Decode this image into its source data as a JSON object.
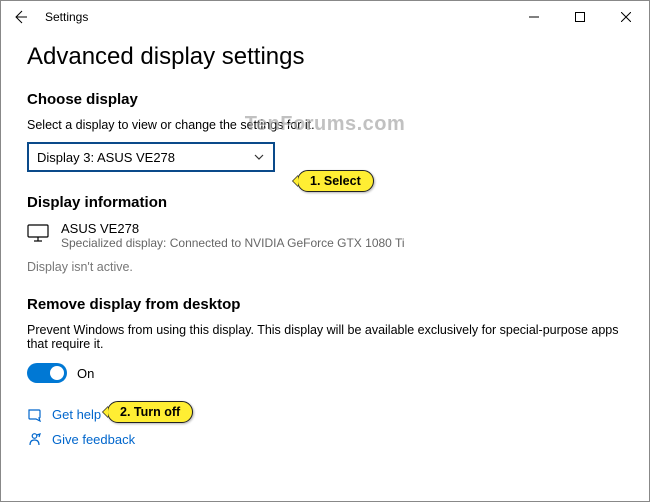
{
  "window": {
    "title": "Settings"
  },
  "page": {
    "heading": "Advanced display settings"
  },
  "choose": {
    "heading": "Choose display",
    "hint": "Select a display to view or change the settings for it.",
    "selected": "Display 3: ASUS VE278"
  },
  "info": {
    "heading": "Display information",
    "device_name": "ASUS VE278",
    "device_detail": "Specialized display: Connected to NVIDIA GeForce GTX 1080 Ti",
    "inactive": "Display isn't active."
  },
  "remove": {
    "heading": "Remove display from desktop",
    "desc": "Prevent Windows from using this display. This display will be available exclusively for special-purpose apps that require it.",
    "toggle_label": "On"
  },
  "links": {
    "help": "Get help",
    "feedback": "Give feedback"
  },
  "callouts": {
    "one": "1.  Select",
    "two": "2.  Turn off"
  },
  "watermark": "TenForums.com"
}
